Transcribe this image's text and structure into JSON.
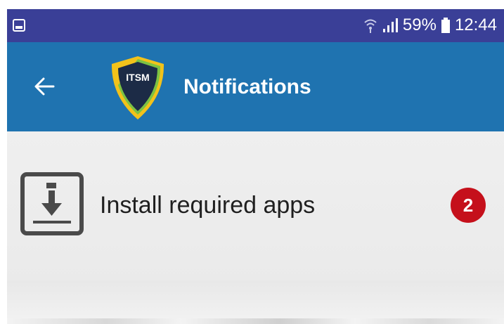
{
  "status_bar": {
    "battery_percent": "59%",
    "time": "12:44",
    "left_icon": "gallery-icon",
    "icons": [
      "wifi-icon",
      "signal-icon",
      "battery-icon"
    ]
  },
  "app_bar": {
    "back_icon": "back-arrow-icon",
    "logo_text": "ITSM",
    "title": "Notifications"
  },
  "notifications": [
    {
      "icon": "install-download-icon",
      "label": "Install required apps",
      "count": "2"
    }
  ],
  "colors": {
    "status_bar": "#3a3f97",
    "app_bar": "#1f73b0",
    "badge": "#c5101b",
    "content_bg": "#ececec"
  }
}
